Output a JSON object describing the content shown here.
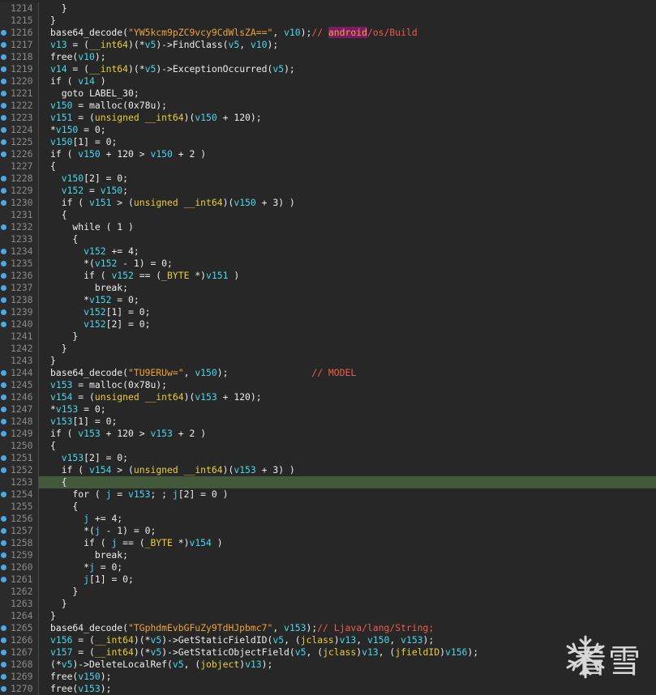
{
  "editor": {
    "lines": [
      {
        "n": "1214",
        "bp": false,
        "tokens": [
          [
            "",
            ""
          ]
        ],
        "indent": "  }"
      },
      {
        "n": "1215",
        "bp": false,
        "indent": "}"
      },
      {
        "n": "1216",
        "bp": true,
        "tokens": [
          [
            "fn",
            "base64_decode("
          ],
          [
            "str",
            "\"YW5kcm9pZC9vcy9CdWlsZA==\""
          ],
          [
            "fn",
            ", "
          ],
          [
            "var",
            "v10"
          ],
          [
            "fn",
            ");"
          ],
          [
            "cmt",
            "// "
          ],
          [
            "hl",
            "android"
          ],
          [
            "cmt",
            "/os/Build"
          ]
        ]
      },
      {
        "n": "1217",
        "bp": true,
        "tokens": [
          [
            "var",
            "v13"
          ],
          [
            "fn",
            " = ("
          ],
          [
            "type",
            "__int64"
          ],
          [
            "fn",
            ")(*"
          ],
          [
            "var",
            "v5"
          ],
          [
            "fn",
            ")->FindClass("
          ],
          [
            "var",
            "v5"
          ],
          [
            "fn",
            ", "
          ],
          [
            "var",
            "v10"
          ],
          [
            "fn",
            ");"
          ]
        ]
      },
      {
        "n": "1218",
        "bp": true,
        "tokens": [
          [
            "fn",
            "free("
          ],
          [
            "var",
            "v10"
          ],
          [
            "fn",
            ");"
          ]
        ]
      },
      {
        "n": "1219",
        "bp": true,
        "tokens": [
          [
            "var",
            "v14"
          ],
          [
            "fn",
            " = ("
          ],
          [
            "type",
            "__int64"
          ],
          [
            "fn",
            ")(*"
          ],
          [
            "var",
            "v5"
          ],
          [
            "fn",
            ")->ExceptionOccurred("
          ],
          [
            "var",
            "v5"
          ],
          [
            "fn",
            ");"
          ]
        ]
      },
      {
        "n": "1220",
        "bp": true,
        "tokens": [
          [
            "fn",
            "if ( "
          ],
          [
            "var",
            "v14"
          ],
          [
            "fn",
            " )"
          ]
        ]
      },
      {
        "n": "1221",
        "bp": true,
        "tokens": [
          [
            "fn",
            "  goto LABEL_30;"
          ]
        ]
      },
      {
        "n": "1222",
        "bp": true,
        "tokens": [
          [
            "var",
            "v150"
          ],
          [
            "fn",
            " = malloc(0x78u);"
          ]
        ]
      },
      {
        "n": "1223",
        "bp": true,
        "tokens": [
          [
            "var",
            "v151"
          ],
          [
            "fn",
            " = ("
          ],
          [
            "type",
            "unsigned __int64"
          ],
          [
            "fn",
            ")("
          ],
          [
            "var",
            "v150"
          ],
          [
            "fn",
            " + 120);"
          ]
        ]
      },
      {
        "n": "1224",
        "bp": true,
        "tokens": [
          [
            "fn",
            "*"
          ],
          [
            "var",
            "v150"
          ],
          [
            "fn",
            " = 0;"
          ]
        ]
      },
      {
        "n": "1225",
        "bp": true,
        "tokens": [
          [
            "var",
            "v150"
          ],
          [
            "fn",
            "[1] = 0;"
          ]
        ]
      },
      {
        "n": "1226",
        "bp": true,
        "tokens": [
          [
            "fn",
            "if ( "
          ],
          [
            "var",
            "v150"
          ],
          [
            "fn",
            " + 120 > "
          ],
          [
            "var",
            "v150"
          ],
          [
            "fn",
            " + 2 )"
          ]
        ]
      },
      {
        "n": "1227",
        "bp": false,
        "tokens": [
          [
            "fn",
            "{"
          ]
        ]
      },
      {
        "n": "1228",
        "bp": true,
        "tokens": [
          [
            "fn",
            "  "
          ],
          [
            "var",
            "v150"
          ],
          [
            "fn",
            "[2] = 0;"
          ]
        ]
      },
      {
        "n": "1229",
        "bp": true,
        "tokens": [
          [
            "fn",
            "  "
          ],
          [
            "var",
            "v152"
          ],
          [
            "fn",
            " = "
          ],
          [
            "var",
            "v150"
          ],
          [
            "fn",
            ";"
          ]
        ]
      },
      {
        "n": "1230",
        "bp": true,
        "tokens": [
          [
            "fn",
            "  if ( "
          ],
          [
            "var",
            "v151"
          ],
          [
            "fn",
            " > ("
          ],
          [
            "type",
            "unsigned __int64"
          ],
          [
            "fn",
            ")("
          ],
          [
            "var",
            "v150"
          ],
          [
            "fn",
            " + 3) )"
          ]
        ]
      },
      {
        "n": "1231",
        "bp": false,
        "tokens": [
          [
            "fn",
            "  {"
          ]
        ]
      },
      {
        "n": "1232",
        "bp": true,
        "tokens": [
          [
            "fn",
            "    while ( 1 )"
          ]
        ]
      },
      {
        "n": "1233",
        "bp": false,
        "tokens": [
          [
            "fn",
            "    {"
          ]
        ]
      },
      {
        "n": "1234",
        "bp": true,
        "tokens": [
          [
            "fn",
            "      "
          ],
          [
            "var",
            "v152"
          ],
          [
            "fn",
            " += 4;"
          ]
        ]
      },
      {
        "n": "1235",
        "bp": true,
        "tokens": [
          [
            "fn",
            "      *("
          ],
          [
            "var",
            "v152"
          ],
          [
            "fn",
            " - 1) = 0;"
          ]
        ]
      },
      {
        "n": "1236",
        "bp": true,
        "tokens": [
          [
            "fn",
            "      if ( "
          ],
          [
            "var",
            "v152"
          ],
          [
            "fn",
            " == ("
          ],
          [
            "type",
            "_BYTE"
          ],
          [
            "fn",
            " *)"
          ],
          [
            "var",
            "v151"
          ],
          [
            "fn",
            " )"
          ]
        ]
      },
      {
        "n": "1237",
        "bp": true,
        "tokens": [
          [
            "fn",
            "        break;"
          ]
        ]
      },
      {
        "n": "1238",
        "bp": true,
        "tokens": [
          [
            "fn",
            "      *"
          ],
          [
            "var",
            "v152"
          ],
          [
            "fn",
            " = 0;"
          ]
        ]
      },
      {
        "n": "1239",
        "bp": true,
        "tokens": [
          [
            "fn",
            "      "
          ],
          [
            "var",
            "v152"
          ],
          [
            "fn",
            "[1] = 0;"
          ]
        ]
      },
      {
        "n": "1240",
        "bp": true,
        "tokens": [
          [
            "fn",
            "      "
          ],
          [
            "var",
            "v152"
          ],
          [
            "fn",
            "[2] = 0;"
          ]
        ]
      },
      {
        "n": "1241",
        "bp": false,
        "tokens": [
          [
            "fn",
            "    }"
          ]
        ]
      },
      {
        "n": "1242",
        "bp": false,
        "tokens": [
          [
            "fn",
            "  }"
          ]
        ]
      },
      {
        "n": "1243",
        "bp": false,
        "tokens": [
          [
            "fn",
            "}"
          ]
        ]
      },
      {
        "n": "1244",
        "bp": true,
        "tokens": [
          [
            "fn",
            "base64_decode("
          ],
          [
            "str",
            "\"TU9ERUw=\""
          ],
          [
            "fn",
            ", "
          ],
          [
            "var",
            "v150"
          ],
          [
            "fn",
            ");               "
          ],
          [
            "cmt",
            "// MODEL"
          ]
        ]
      },
      {
        "n": "1245",
        "bp": true,
        "tokens": [
          [
            "var",
            "v153"
          ],
          [
            "fn",
            " = malloc(0x78u);"
          ]
        ]
      },
      {
        "n": "1246",
        "bp": true,
        "tokens": [
          [
            "var",
            "v154"
          ],
          [
            "fn",
            " = ("
          ],
          [
            "type",
            "unsigned __int64"
          ],
          [
            "fn",
            ")("
          ],
          [
            "var",
            "v153"
          ],
          [
            "fn",
            " + 120);"
          ]
        ]
      },
      {
        "n": "1247",
        "bp": true,
        "tokens": [
          [
            "fn",
            "*"
          ],
          [
            "var",
            "v153"
          ],
          [
            "fn",
            " = 0;"
          ]
        ]
      },
      {
        "n": "1248",
        "bp": true,
        "tokens": [
          [
            "var",
            "v153"
          ],
          [
            "fn",
            "[1] = 0;"
          ]
        ]
      },
      {
        "n": "1249",
        "bp": true,
        "tokens": [
          [
            "fn",
            "if ( "
          ],
          [
            "var",
            "v153"
          ],
          [
            "fn",
            " + 120 > "
          ],
          [
            "var",
            "v153"
          ],
          [
            "fn",
            " + 2 )"
          ]
        ]
      },
      {
        "n": "1250",
        "bp": false,
        "tokens": [
          [
            "fn",
            "{"
          ]
        ]
      },
      {
        "n": "1251",
        "bp": true,
        "tokens": [
          [
            "fn",
            "  "
          ],
          [
            "var",
            "v153"
          ],
          [
            "fn",
            "[2] = 0;"
          ]
        ]
      },
      {
        "n": "1252",
        "bp": true,
        "tokens": [
          [
            "fn",
            "  if ( "
          ],
          [
            "var",
            "v154"
          ],
          [
            "fn",
            " > ("
          ],
          [
            "type",
            "unsigned __int64"
          ],
          [
            "fn",
            ")("
          ],
          [
            "var",
            "v153"
          ],
          [
            "fn",
            " + 3) )"
          ]
        ]
      },
      {
        "n": "1253",
        "bp": false,
        "current": true,
        "tokens": [
          [
            "fn",
            "  {"
          ]
        ]
      },
      {
        "n": "1254",
        "bp": true,
        "tokens": [
          [
            "fn",
            "    for ( "
          ],
          [
            "var",
            "j"
          ],
          [
            "fn",
            " = "
          ],
          [
            "var",
            "v153"
          ],
          [
            "fn",
            "; ; "
          ],
          [
            "var",
            "j"
          ],
          [
            "fn",
            "[2] = 0 )"
          ]
        ]
      },
      {
        "n": "1255",
        "bp": false,
        "tokens": [
          [
            "fn",
            "    {"
          ]
        ]
      },
      {
        "n": "1256",
        "bp": true,
        "tokens": [
          [
            "fn",
            "      "
          ],
          [
            "var",
            "j"
          ],
          [
            "fn",
            " += 4;"
          ]
        ]
      },
      {
        "n": "1257",
        "bp": true,
        "tokens": [
          [
            "fn",
            "      *("
          ],
          [
            "var",
            "j"
          ],
          [
            "fn",
            " - 1) = 0;"
          ]
        ]
      },
      {
        "n": "1258",
        "bp": true,
        "tokens": [
          [
            "fn",
            "      if ( "
          ],
          [
            "var",
            "j"
          ],
          [
            "fn",
            " == ("
          ],
          [
            "type",
            "_BYTE"
          ],
          [
            "fn",
            " *)"
          ],
          [
            "var",
            "v154"
          ],
          [
            "fn",
            " )"
          ]
        ]
      },
      {
        "n": "1259",
        "bp": true,
        "tokens": [
          [
            "fn",
            "        break;"
          ]
        ]
      },
      {
        "n": "1260",
        "bp": true,
        "tokens": [
          [
            "fn",
            "      *"
          ],
          [
            "var",
            "j"
          ],
          [
            "fn",
            " = 0;"
          ]
        ]
      },
      {
        "n": "1261",
        "bp": true,
        "tokens": [
          [
            "fn",
            "      "
          ],
          [
            "var",
            "j"
          ],
          [
            "fn",
            "[1] = 0;"
          ]
        ]
      },
      {
        "n": "1262",
        "bp": false,
        "tokens": [
          [
            "fn",
            "    }"
          ]
        ]
      },
      {
        "n": "1263",
        "bp": false,
        "tokens": [
          [
            "fn",
            "  }"
          ]
        ]
      },
      {
        "n": "1264",
        "bp": false,
        "tokens": [
          [
            "fn",
            "}"
          ]
        ]
      },
      {
        "n": "1265",
        "bp": true,
        "tokens": [
          [
            "fn",
            "base64_decode("
          ],
          [
            "str",
            "\"TGphdmEvbGFuZy9TdHJpbmc7\""
          ],
          [
            "fn",
            ", "
          ],
          [
            "var",
            "v153"
          ],
          [
            "fn",
            ");"
          ],
          [
            "cmt",
            "// Ljava/lang/String;"
          ]
        ]
      },
      {
        "n": "1266",
        "bp": true,
        "tokens": [
          [
            "var",
            "v156"
          ],
          [
            "fn",
            " = ("
          ],
          [
            "type",
            "__int64"
          ],
          [
            "fn",
            ")(*"
          ],
          [
            "var",
            "v5"
          ],
          [
            "fn",
            ")->GetStaticFieldID("
          ],
          [
            "var",
            "v5"
          ],
          [
            "fn",
            ", ("
          ],
          [
            "type",
            "jclass"
          ],
          [
            "fn",
            ")"
          ],
          [
            "var",
            "v13"
          ],
          [
            "fn",
            ", "
          ],
          [
            "var",
            "v150"
          ],
          [
            "fn",
            ", "
          ],
          [
            "var",
            "v153"
          ],
          [
            "fn",
            ");"
          ]
        ]
      },
      {
        "n": "1267",
        "bp": true,
        "tokens": [
          [
            "var",
            "v157"
          ],
          [
            "fn",
            " = ("
          ],
          [
            "type",
            "__int64"
          ],
          [
            "fn",
            ")(*"
          ],
          [
            "var",
            "v5"
          ],
          [
            "fn",
            ")->GetStaticObjectField("
          ],
          [
            "var",
            "v5"
          ],
          [
            "fn",
            ", ("
          ],
          [
            "type",
            "jclass"
          ],
          [
            "fn",
            ")"
          ],
          [
            "var",
            "v13"
          ],
          [
            "fn",
            ", ("
          ],
          [
            "type",
            "jfieldID"
          ],
          [
            "fn",
            ")"
          ],
          [
            "var",
            "v156"
          ],
          [
            "fn",
            ");"
          ]
        ]
      },
      {
        "n": "1268",
        "bp": true,
        "tokens": [
          [
            "fn",
            "(*"
          ],
          [
            "var",
            "v5"
          ],
          [
            "fn",
            ")->DeleteLocalRef("
          ],
          [
            "var",
            "v5"
          ],
          [
            "fn",
            ", ("
          ],
          [
            "type",
            "jobject"
          ],
          [
            "fn",
            ")"
          ],
          [
            "var",
            "v13"
          ],
          [
            "fn",
            ");"
          ]
        ]
      },
      {
        "n": "1269",
        "bp": true,
        "tokens": [
          [
            "fn",
            "free("
          ],
          [
            "var",
            "v150"
          ],
          [
            "fn",
            ");"
          ]
        ]
      },
      {
        "n": "1270",
        "bp": true,
        "tokens": [
          [
            "fn",
            "free("
          ],
          [
            "var",
            "v153"
          ],
          [
            "fn",
            ");"
          ]
        ]
      }
    ]
  },
  "colors": {
    "background": "#272727",
    "variable": "#48d8ec",
    "type": "#e9cf3a",
    "string": "#f0a23c",
    "comment": "#ef5b4d",
    "current_line": "#42593c",
    "breakpoint": "#4ea8e6"
  },
  "watermark": {
    "icon": "snowflake-icon",
    "text": "看雪"
  }
}
